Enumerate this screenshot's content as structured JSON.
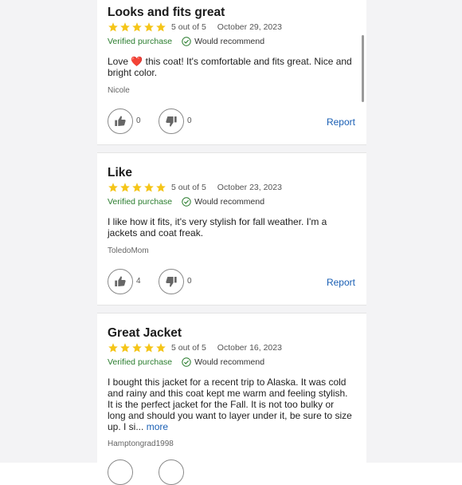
{
  "reviews": [
    {
      "title": "Looks and fits great",
      "rating": 5,
      "rating_text": "5 out of 5",
      "date": "October 29, 2023",
      "verified": "Verified purchase",
      "recommend": "Would recommend",
      "body_before": "Love ",
      "body_emoji": "❤️",
      "body_after": " this coat! It's comfortable and fits great. Nice and bright color.",
      "author": "Nicole",
      "helpful_count": "0",
      "unhelpful_count": "0",
      "report_label": "Report"
    },
    {
      "title": "Like",
      "rating": 5,
      "rating_text": "5 out of 5",
      "date": "October 23, 2023",
      "verified": "Verified purchase",
      "recommend": "Would recommend",
      "body": "I like how it fits, it's very stylish for fall weather. I'm a jackets and coat freak.",
      "author": "ToledoMom",
      "helpful_count": "4",
      "unhelpful_count": "0",
      "report_label": "Report"
    },
    {
      "title": "Great Jacket",
      "rating": 5,
      "rating_text": "5 out of 5",
      "date": "October 16, 2023",
      "verified": "Verified purchase",
      "recommend": "Would recommend",
      "body": "I bought this jacket for a recent trip to Alaska. It was cold and rainy and this coat kept me warm and feeling stylish. It is the perfect jacket for the Fall. It is not too bulky or long and should you want to layer under it, be sure to size up. I si...",
      "more_label": "more",
      "author": "Hamptongrad1998"
    }
  ],
  "colors": {
    "star": "#f5c518",
    "verified": "#2a7d2e",
    "link": "#1a5fb4",
    "separator": "#f3f3f5"
  }
}
